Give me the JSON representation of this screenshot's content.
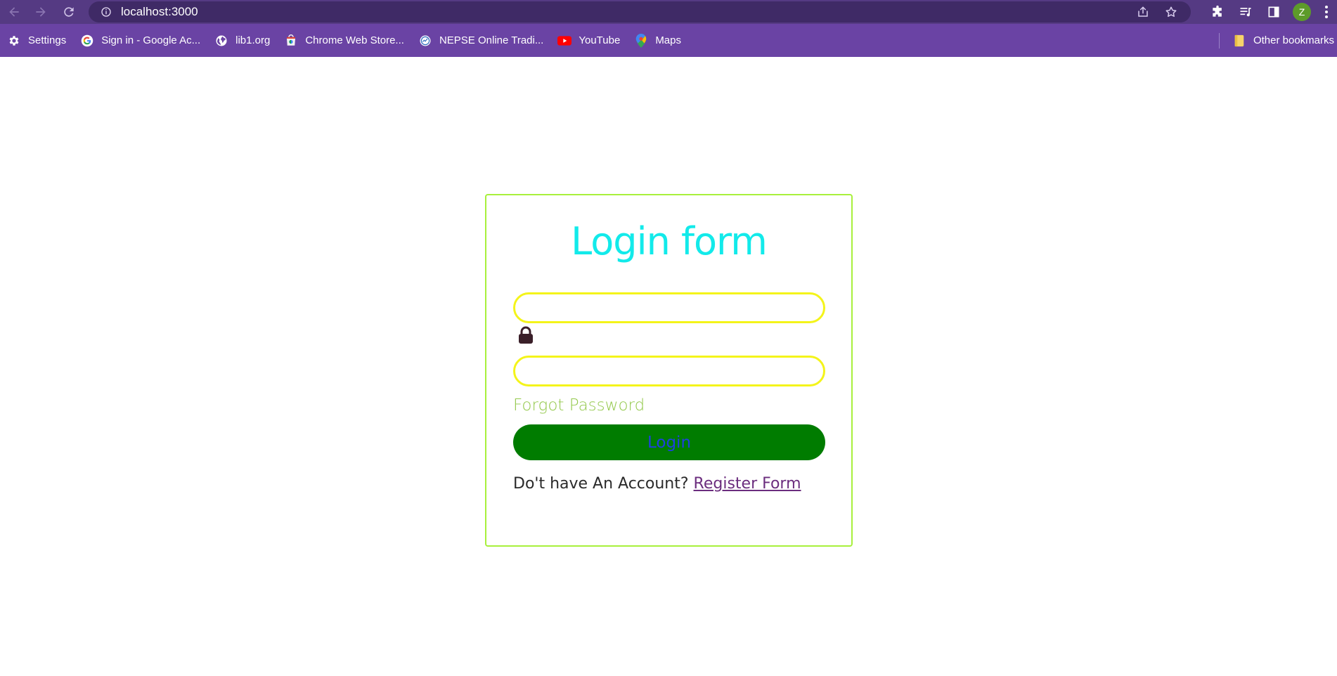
{
  "browser": {
    "url": "localhost:3000",
    "profile_initial": "Z",
    "accent_color": "#553a83",
    "bookmarks_bar_color": "#6a43a4"
  },
  "bookmarks": [
    {
      "label": "Settings",
      "icon": "gear-icon"
    },
    {
      "label": "Sign in - Google Ac...",
      "icon": "google-icon"
    },
    {
      "label": "lib1.org",
      "icon": "globe-icon"
    },
    {
      "label": "Chrome Web Store...",
      "icon": "webstore-icon"
    },
    {
      "label": "NEPSE Online Tradi...",
      "icon": "nepse-icon"
    },
    {
      "label": "YouTube",
      "icon": "youtube-icon"
    },
    {
      "label": "Maps",
      "icon": "maps-icon"
    }
  ],
  "other_bookmarks": "Other bookmarks",
  "login": {
    "title": "Login form",
    "username_value": "",
    "password_value": "",
    "forgot_password": "Forgot Password",
    "login_button": "Login",
    "no_account_text": "Do't have An Account?",
    "register_link": "Register Form",
    "colors": {
      "title": "#12eaea",
      "input_border": "#f4f41a",
      "card_border": "#a8f03c",
      "forgot": "#93c84b",
      "button_bg": "#007c00",
      "button_text": "#1f3fe0"
    }
  }
}
